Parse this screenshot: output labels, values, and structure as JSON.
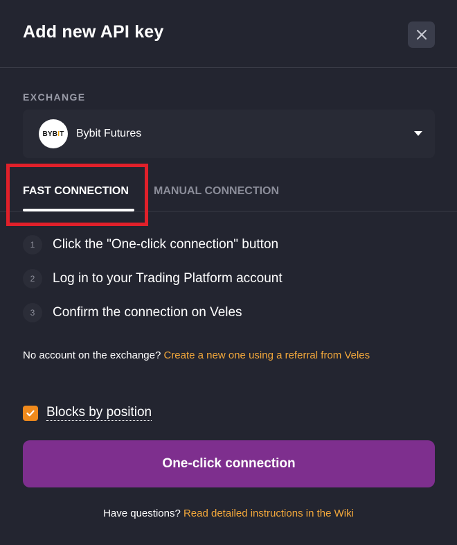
{
  "dialog": {
    "title": "Add new API key",
    "close_icon": "close-icon"
  },
  "exchange": {
    "label": "EXCHANGE",
    "selected": "Bybit Futures",
    "logo_text_left": "BYB",
    "logo_text_mid": "I",
    "logo_text_right": "T",
    "logo_accent": "#f7a600"
  },
  "tabs": [
    {
      "label": "FAST CONNECTION",
      "active": true
    },
    {
      "label": "MANUAL CONNECTION",
      "active": false
    }
  ],
  "steps": [
    {
      "number": "1",
      "text": "Click the \"One-click connection\" button"
    },
    {
      "number": "2",
      "text": "Log in to your Trading Platform account"
    },
    {
      "number": "3",
      "text": "Confirm the connection on Veles"
    }
  ],
  "referral": {
    "prefix": "No account on the exchange? ",
    "link": "Create a new one using a referral from Veles"
  },
  "blocks_by_position": {
    "label": "Blocks by position",
    "checked": true
  },
  "primary_button": {
    "label": "One-click connection"
  },
  "help": {
    "prefix": "Have questions? ",
    "link": "Read detailed instructions in the Wiki"
  },
  "colors": {
    "background": "#232530",
    "accent_link": "#f3a83b",
    "primary_button": "#7e2f8e",
    "checkbox": "#f08a1c",
    "highlight": "#e0202a"
  }
}
